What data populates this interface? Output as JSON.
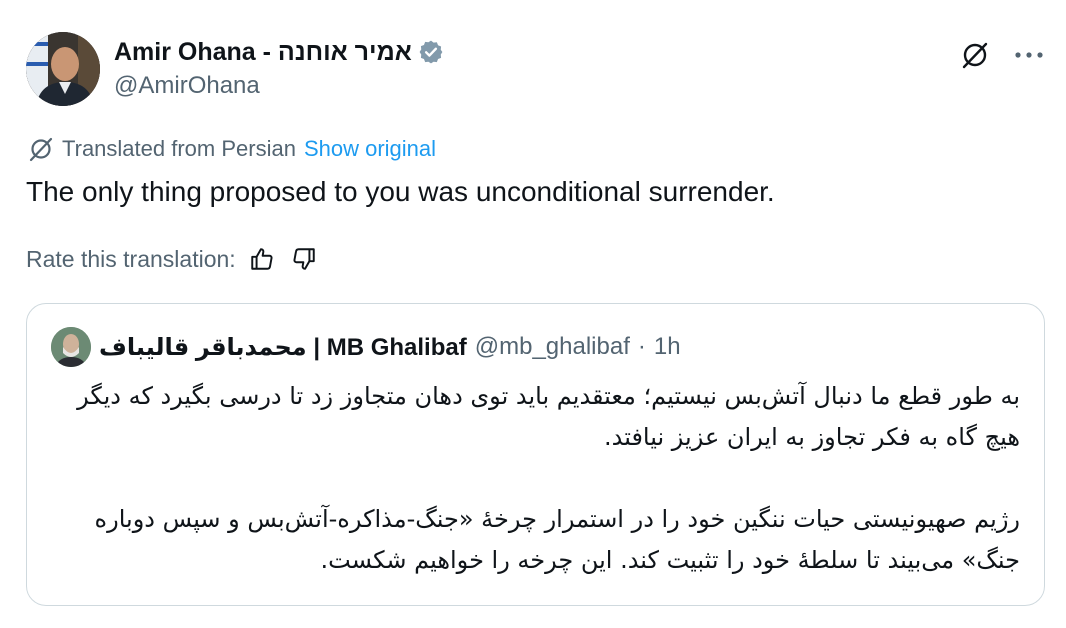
{
  "author": {
    "display_name": "Amir Ohana - אמיר אוחנה",
    "handle": "@AmirOhana",
    "verified_icon": "verified-badge-icon"
  },
  "translation": {
    "label": "Translated from Persian",
    "show_original": "Show original",
    "icon": "translate-icon"
  },
  "tweet": {
    "text": "The only thing proposed to you was unconditional surrender."
  },
  "rating": {
    "label": "Rate this translation:",
    "up_icon": "thumbs-up-icon",
    "down_icon": "thumbs-down-icon"
  },
  "quote": {
    "name": "محمدباقر قالیباف | MB Ghalibaf",
    "handle": "@mb_ghalibaf",
    "separator": "·",
    "time": "1h",
    "paragraphs": [
      "به طور قطع ما دنبال آتش‌بس نیستیم؛ معتقدیم باید توی دهان متجاوز زد تا درسی بگیرد که دیگر هیچ گاه به فکر تجاوز به ایران عزیز نیافتد.",
      "رژیم صهیونیستی حیات ننگین خود را در استمرار چرخهٔ «جنگ-مذاکره-آتش‌بس و سپس دوباره جنگ» می‌بیند تا سلطهٔ خود را تثبیت کند. این چرخه را خواهیم شکست."
    ]
  },
  "colors": {
    "text": "#0f1419",
    "secondary": "#536471",
    "link": "#1d9bf0",
    "verified": "#829aab",
    "border": "#cfd9de"
  }
}
